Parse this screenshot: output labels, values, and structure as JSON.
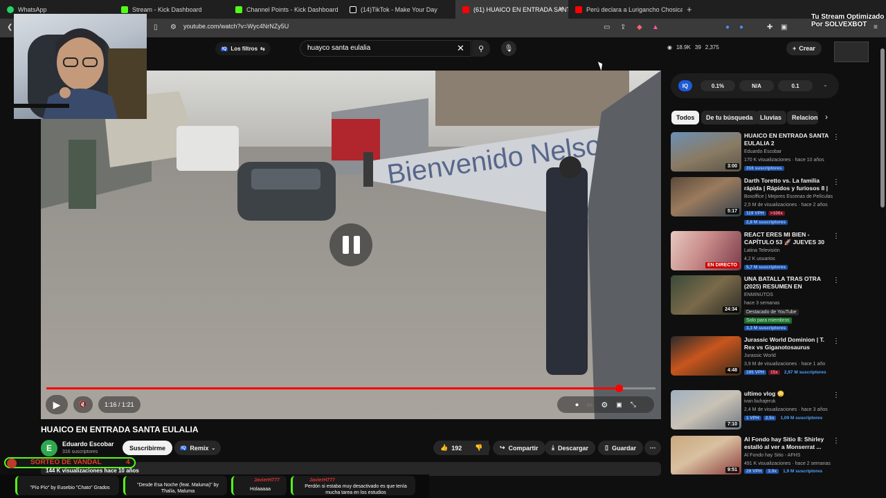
{
  "browser": {
    "tabs": [
      {
        "title": "WhatsApp",
        "favicon_color": "#25d366"
      },
      {
        "title": "Stream - Kick Dashboard",
        "favicon_color": "#53fc18"
      },
      {
        "title": "Channel Points - Kick Dashboard",
        "favicon_color": "#53fc18"
      },
      {
        "title": "(14)TikTok - Make Your Day",
        "favicon_color": "#ffffff"
      },
      {
        "title": "(61) HUAICO EN ENTRADA SANT",
        "favicon_color": "#ff0000",
        "active": true
      },
      {
        "title": "Perú declara a Lurigancho Chosica c",
        "favicon_color": "#ff0000"
      }
    ],
    "new_tab": "+",
    "tab_close": "✕",
    "address": "youtube.com/watch?v=Wyc4NrNZy5U"
  },
  "yt_header": {
    "filters_label": "Los filtros",
    "search_value": "huayco santa eulalia",
    "clear": "✕",
    "stats": {
      "views": "18.9K",
      "comments": "39",
      "likes": "2,375"
    },
    "create_label": "Crear"
  },
  "player": {
    "time": "1:16 / 1:21",
    "progress": 0.94
  },
  "video": {
    "title": "HUAICO EN ENTRADA SANTA EULALIA",
    "channel": "Eduardo Escobar",
    "channel_initial": "E",
    "subscribers": "316 suscriptores",
    "subscribe_label": "Suscribirme",
    "remix_label": "Remix",
    "likes": "192",
    "share_label": "Compartir",
    "download_label": "Descargar",
    "save_label": "Guardar",
    "views_line": "144 K visualizaciones  hace 10 años"
  },
  "sidebar": {
    "iq": {
      "label": "IQ",
      "a": "0.1%",
      "b": "N/A",
      "c": "0.1"
    },
    "chips": [
      "Todos",
      "De tu búsqueda",
      "Lluvias",
      "Relacion"
    ],
    "recs": [
      {
        "title": "HUAICO EN ENTRADA SANTA EULALIA 2",
        "channel": "Eduardo Escobar",
        "meta": "170 K visualizaciones · hace 10 años",
        "extra": "316 suscriptores",
        "duration": "3:00"
      },
      {
        "title": "Darth Toretto vs. La familia rápida | Rápidos y furiosos 8 | ...",
        "channel": "Boxoffice | Mejores Escenas de Películas",
        "meta": "2,5 M de visualizaciones · hace 2 años",
        "vph": "119 VPH",
        "mult": ">100x",
        "extra": "2,8 M suscriptores",
        "duration": "5:17"
      },
      {
        "title": "REACT ERES MI BIEN - CAPÍTULO 53 🚀 JUEVES 30 ...",
        "channel": "Latina Televisión",
        "meta": "4,2 K usuarios",
        "extra": "5,7 M suscriptores",
        "live": "EN DIRECTO"
      },
      {
        "title": "UNA BATALLA TRAS OTRA (2025) RESUMEN EN MINUTOS",
        "channel": "ENMINUTOS",
        "meta": "hace 3 semanas",
        "note": "Destacado de YouTube",
        "members": "Solo para miembros",
        "extra": "3,3 M suscriptores",
        "duration": "24:34"
      },
      {
        "title": "Jurassic World Dominion | T. Rex vs Giganotosaurus",
        "channel": "Jurassic World",
        "meta": "3,9 M de visualizaciones · hace 1 año",
        "vph": "195 VPH",
        "mult": "15x",
        "extra": "2,97 M suscriptores",
        "duration": "4:48"
      },
      {
        "title": "ultimo vlog 😳",
        "channel": "ivan buhajeruk",
        "meta": "2,4 M de visualizaciones · hace 3 años",
        "vph": "1 VPH",
        "mult": "2.5x",
        "extra": "1,09 M suscriptores",
        "duration": "7:10"
      },
      {
        "title": "Al Fondo hay Sitio 8: Shirley estalló al ver a Monserrat ...",
        "channel": "Al Fondo hay Sitio - AFHS",
        "meta": "491 K visualizaciones · hace 2 semanas",
        "vph": "29 VPH",
        "mult": "3.9x",
        "extra": "1,9 M suscriptores",
        "duration": "9:51"
      }
    ]
  },
  "overlay": {
    "brand_line1": "Tu Stream Optimizado",
    "brand_line2": "Por SOLVEXBOT",
    "raffle_label": "SORTEO DE VANDAL",
    "raffle_count": "4",
    "chat": [
      {
        "msg": "\"Pío Pío\" by Eusebio \"Chato\" Grados"
      },
      {
        "msg": "\"Desde Esa Noche (feat. Maluma)\" by Thalía, Maluma"
      },
      {
        "user": "JavierH777",
        "msg": "Holaaaaa"
      },
      {
        "user": "JavierH777",
        "msg": "Perdón si estaba muy desactivado es que tenía mucha tarea en los estudios"
      }
    ]
  }
}
